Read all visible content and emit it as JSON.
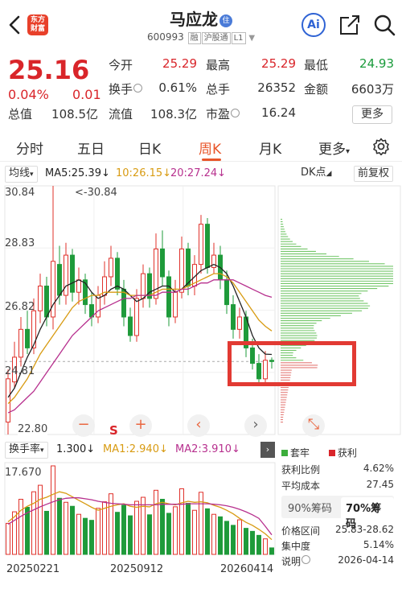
{
  "header": {
    "stock_name": "马应龙",
    "zhu_badge": "住",
    "code": "600993",
    "tags": [
      "融",
      "沪股通",
      "L1"
    ],
    "logo_text": "东方财富"
  },
  "quote": {
    "price": "25.16",
    "change_pct": "0.04%",
    "change_abs": "0.01",
    "open_label": "今开",
    "open": "25.29",
    "high_label": "最高",
    "high": "25.29",
    "low_label": "最低",
    "low": "24.93",
    "turnover_label": "换手",
    "turnover": "0.61%",
    "volume_label": "总手",
    "volume": "26352",
    "amount_label": "金额",
    "amount": "6603万",
    "mcap_label": "总值",
    "mcap": "108.5亿",
    "float_label": "流值",
    "float": "108.3亿",
    "pe_label": "市盈",
    "pe": "16.24",
    "more_label": "更多"
  },
  "tabs": [
    "分时",
    "五日",
    "日K",
    "周K",
    "月K",
    "更多"
  ],
  "active_tab": "周K",
  "indicators": {
    "ma_type": "均线",
    "ma5": "MA5:25.39↓",
    "ma10": "10:26.15↓",
    "ma20": "20:27.24↓",
    "dk_btn": "DK点",
    "adjust_btn": "前复权"
  },
  "price_axis": {
    "top": "30.84",
    "l2": "28.83",
    "l3": "26.82",
    "l4": "24.81",
    "bottom": "22.80",
    "max_marker": "<-30.84",
    "min_marker": "22.80"
  },
  "volume": {
    "label": "换手率",
    "value": "1.300↓",
    "ma1": "MA1:2.940↓",
    "ma2": "MA2:3.910↓",
    "max": "17.670"
  },
  "dates": [
    "20250221",
    "20250912",
    "20260414"
  ],
  "chip": {
    "legend_trap": "套牢",
    "legend_profit": "获利",
    "profit_ratio_label": "获利比例",
    "profit_ratio": "4.62%",
    "avg_cost_label": "平均成本",
    "avg_cost": "27.45",
    "tab90": "90%筹码",
    "tab70": "70%筹码",
    "range_label": "价格区间",
    "range": "25.83-28.62",
    "concentration_label": "集中度",
    "concentration": "5.14%",
    "note_label": "说明",
    "note_date": "2026-04-14"
  },
  "chart_data": {
    "type": "candlestick",
    "period": "weekly",
    "ylim": [
      22.8,
      30.84
    ],
    "candles": [
      {
        "o": 23.2,
        "c": 24.6,
        "h": 24.9,
        "l": 22.8
      },
      {
        "o": 24.5,
        "c": 25.3,
        "h": 25.8,
        "l": 24.3
      },
      {
        "o": 25.3,
        "c": 26.2,
        "h": 26.6,
        "l": 25.0
      },
      {
        "o": 26.2,
        "c": 25.6,
        "h": 26.8,
        "l": 25.4
      },
      {
        "o": 25.6,
        "c": 26.8,
        "h": 27.2,
        "l": 25.4
      },
      {
        "o": 26.8,
        "c": 27.6,
        "h": 28.0,
        "l": 26.4
      },
      {
        "o": 27.6,
        "c": 26.6,
        "h": 27.9,
        "l": 26.3
      },
      {
        "o": 26.6,
        "c": 28.4,
        "h": 30.84,
        "l": 26.2
      },
      {
        "o": 28.3,
        "c": 27.3,
        "h": 28.9,
        "l": 27.0
      },
      {
        "o": 27.3,
        "c": 28.6,
        "h": 29.0,
        "l": 27.0
      },
      {
        "o": 28.6,
        "c": 27.4,
        "h": 28.8,
        "l": 27.1
      },
      {
        "o": 27.4,
        "c": 27.8,
        "h": 28.2,
        "l": 27.0
      },
      {
        "o": 27.8,
        "c": 27.0,
        "h": 28.0,
        "l": 26.7
      },
      {
        "o": 27.0,
        "c": 26.6,
        "h": 27.4,
        "l": 26.3
      },
      {
        "o": 26.6,
        "c": 27.3,
        "h": 27.6,
        "l": 26.4
      },
      {
        "o": 27.3,
        "c": 27.9,
        "h": 28.4,
        "l": 27.0
      },
      {
        "o": 27.9,
        "c": 28.5,
        "h": 28.9,
        "l": 27.6
      },
      {
        "o": 28.5,
        "c": 27.5,
        "h": 28.7,
        "l": 27.3
      },
      {
        "o": 27.5,
        "c": 26.6,
        "h": 27.8,
        "l": 26.3
      },
      {
        "o": 26.6,
        "c": 26.0,
        "h": 26.9,
        "l": 25.8
      },
      {
        "o": 26.0,
        "c": 27.2,
        "h": 27.5,
        "l": 25.8
      },
      {
        "o": 27.2,
        "c": 28.0,
        "h": 28.3,
        "l": 26.9
      },
      {
        "o": 28.0,
        "c": 27.2,
        "h": 28.2,
        "l": 26.9
      },
      {
        "o": 27.2,
        "c": 28.8,
        "h": 29.3,
        "l": 27.0
      },
      {
        "o": 28.8,
        "c": 27.9,
        "h": 29.4,
        "l": 27.6
      },
      {
        "o": 27.9,
        "c": 26.6,
        "h": 28.1,
        "l": 26.3
      },
      {
        "o": 26.6,
        "c": 27.4,
        "h": 27.8,
        "l": 26.4
      },
      {
        "o": 27.4,
        "c": 28.8,
        "h": 29.2,
        "l": 27.2
      },
      {
        "o": 28.8,
        "c": 27.6,
        "h": 29.0,
        "l": 27.3
      },
      {
        "o": 27.6,
        "c": 28.3,
        "h": 28.6,
        "l": 27.3
      },
      {
        "o": 28.3,
        "c": 29.6,
        "h": 29.9,
        "l": 28.0
      },
      {
        "o": 29.6,
        "c": 28.2,
        "h": 29.8,
        "l": 28.0
      },
      {
        "o": 28.2,
        "c": 28.6,
        "h": 29.0,
        "l": 28.0
      },
      {
        "o": 28.6,
        "c": 27.8,
        "h": 28.9,
        "l": 27.5
      },
      {
        "o": 27.8,
        "c": 27.0,
        "h": 28.1,
        "l": 26.7
      },
      {
        "o": 27.0,
        "c": 26.2,
        "h": 27.3,
        "l": 25.9
      },
      {
        "o": 26.2,
        "c": 26.6,
        "h": 26.9,
        "l": 25.9
      },
      {
        "o": 26.6,
        "c": 25.6,
        "h": 26.8,
        "l": 25.3
      },
      {
        "o": 25.6,
        "c": 25.1,
        "h": 25.9,
        "l": 24.9
      },
      {
        "o": 25.1,
        "c": 24.6,
        "h": 25.4,
        "l": 24.4
      },
      {
        "o": 24.6,
        "c": 25.2,
        "h": 25.5,
        "l": 24.4
      },
      {
        "o": 25.2,
        "c": 25.16,
        "h": 25.29,
        "l": 24.93
      }
    ],
    "ma5": [
      24.0,
      24.3,
      24.8,
      25.3,
      25.7,
      26.2,
      26.6,
      27.0,
      27.3,
      27.6,
      27.7,
      27.8,
      27.7,
      27.4,
      27.2,
      27.3,
      27.5,
      27.6,
      27.5,
      27.3,
      27.1,
      27.2,
      27.4,
      27.5,
      27.6,
      27.6,
      27.4,
      27.5,
      27.7,
      27.9,
      28.1,
      28.2,
      28.3,
      28.2,
      28.0,
      27.6,
      27.1,
      26.6,
      26.0,
      25.6,
      25.4,
      25.39
    ],
    "ma10": [
      23.8,
      24.0,
      24.3,
      24.6,
      25.0,
      25.4,
      25.7,
      26.0,
      26.3,
      26.6,
      26.9,
      27.1,
      27.2,
      27.3,
      27.3,
      27.4,
      27.4,
      27.4,
      27.4,
      27.3,
      27.3,
      27.3,
      27.3,
      27.4,
      27.5,
      27.5,
      27.5,
      27.5,
      27.6,
      27.7,
      27.8,
      27.9,
      28.0,
      28.0,
      27.9,
      27.7,
      27.4,
      27.1,
      26.8,
      26.5,
      26.3,
      26.15
    ],
    "ma20": [
      23.5,
      23.6,
      23.8,
      24.0,
      24.2,
      24.5,
      24.8,
      25.1,
      25.4,
      25.7,
      26.0,
      26.2,
      26.4,
      26.6,
      26.8,
      26.9,
      27.0,
      27.1,
      27.2,
      27.2,
      27.3,
      27.3,
      27.3,
      27.3,
      27.4,
      27.4,
      27.4,
      27.5,
      27.5,
      27.6,
      27.7,
      27.7,
      27.8,
      27.8,
      27.8,
      27.8,
      27.7,
      27.6,
      27.5,
      27.4,
      27.3,
      27.24
    ],
    "turnover": [
      6.2,
      8.5,
      11.0,
      9.4,
      12.5,
      13.8,
      8.6,
      17.67,
      11.2,
      10.4,
      9.6,
      8.0,
      7.2,
      6.8,
      9.2,
      10.5,
      12.1,
      8.4,
      9.8,
      7.7,
      10.6,
      11.4,
      7.9,
      12.8,
      11.0,
      8.2,
      9.5,
      13.1,
      10.2,
      8.8,
      12.4,
      9.1,
      8.0,
      7.5,
      6.6,
      5.8,
      6.9,
      5.2,
      4.6,
      3.8,
      3.1,
      1.3
    ],
    "turnover_ma1": [
      6.5,
      7.5,
      8.8,
      9.6,
      10.2,
      11.0,
      11.4,
      12.0,
      12.5,
      12.2,
      11.5,
      10.8,
      10.1,
      9.4,
      8.8,
      9.2,
      9.6,
      9.9,
      10.1,
      9.6,
      9.4,
      9.6,
      9.5,
      10.1,
      10.4,
      10.1,
      9.9,
      10.3,
      10.6,
      10.4,
      10.5,
      10.3,
      9.8,
      9.4,
      8.8,
      8.1,
      7.2,
      6.4,
      5.8,
      5.0,
      4.1,
      2.94
    ],
    "turnover_ma2": [
      6.0,
      6.8,
      7.6,
      8.3,
      8.9,
      9.5,
      10.0,
      10.5,
      10.9,
      11.2,
      11.3,
      11.3,
      11.1,
      10.9,
      10.6,
      10.4,
      10.2,
      10.1,
      10.0,
      9.9,
      9.9,
      9.9,
      9.9,
      9.9,
      10.0,
      10.0,
      10.0,
      10.0,
      10.1,
      10.1,
      10.1,
      10.1,
      10.0,
      9.9,
      9.7,
      9.4,
      9.0,
      8.5,
      7.9,
      7.2,
      5.6,
      3.91
    ]
  }
}
